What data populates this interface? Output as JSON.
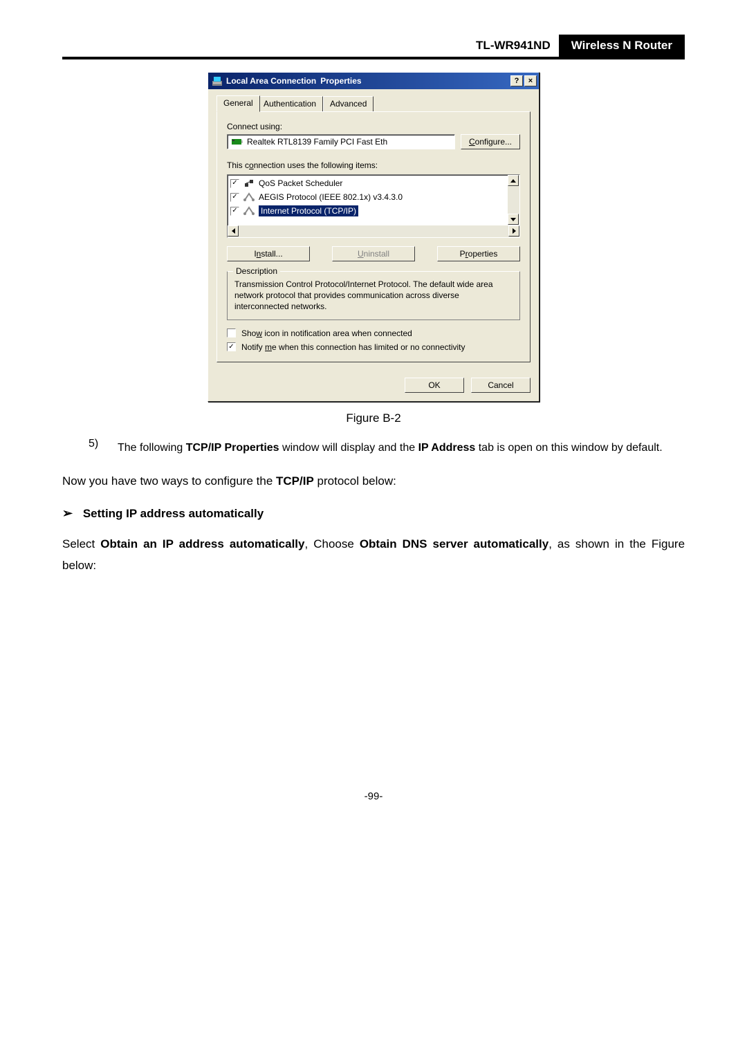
{
  "header": {
    "model": "TL-WR941ND",
    "subtitle": "Wireless  N  Router"
  },
  "dialog": {
    "title_main": "Local Area Connection",
    "title_suffix": "Properties",
    "help": "?",
    "close": "×",
    "tabs": {
      "general": "General",
      "auth": "Authentication",
      "adv": "Advanced"
    },
    "connect_using_label": "Connect using:",
    "adapter": "Realtek RTL8139 Family PCI Fast Eth",
    "configure": "Configure...",
    "items_label": "This connection uses the following items:",
    "items": {
      "0": {
        "label": "QoS Packet Scheduler"
      },
      "1": {
        "label": "AEGIS Protocol (IEEE 802.1x) v3.4.3.0"
      },
      "2": {
        "label": "Internet Protocol (TCP/IP)"
      }
    },
    "install": "Install...",
    "uninstall": "Uninstall",
    "properties": "Properties",
    "desc_legend": "Description",
    "desc_text": "Transmission Control Protocol/Internet Protocol. The default wide area network protocol that provides communication across diverse interconnected networks.",
    "chk_show": "Show icon in notification area when connected",
    "chk_notify": "Notify me when this connection has limited or no connectivity",
    "ok": "OK",
    "cancel": "Cancel"
  },
  "text": {
    "figure": "Figure B-2",
    "step5_num": "5)",
    "step5_a": "The following ",
    "step5_b": "TCP/IP Properties",
    "step5_c": " window will display and the ",
    "step5_d": "IP Address",
    "step5_e": " tab is open on this window by default.",
    "now_a": "Now you have two ways to configure the ",
    "now_b": "TCP/IP",
    "now_c": " protocol below:",
    "setting_auto": "Setting IP address automatically",
    "select_a": "Select ",
    "select_b": "Obtain an IP address automatically",
    "select_c": ", Choose ",
    "select_d": "Obtain DNS server automatically",
    "select_e": ", as shown in the Figure below:",
    "page_num": "-99-"
  }
}
